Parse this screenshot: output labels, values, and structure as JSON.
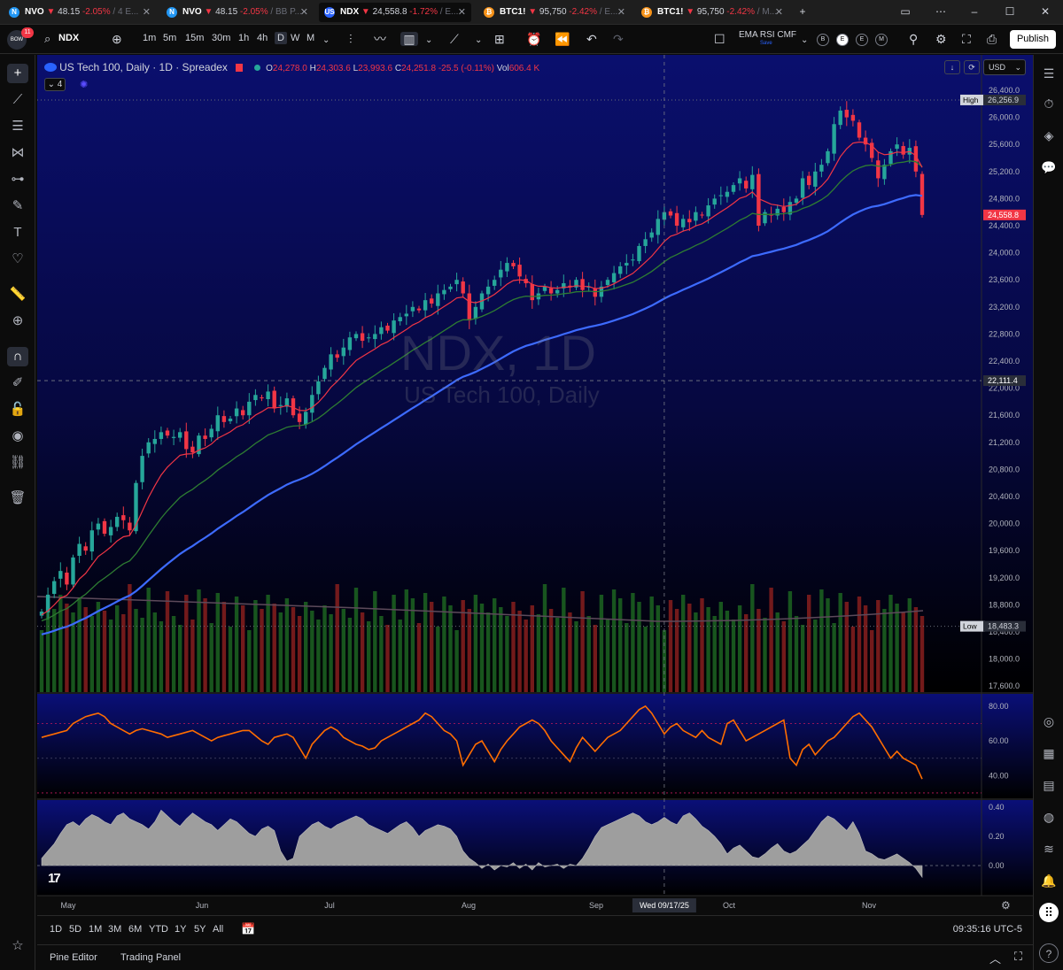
{
  "tabs": [
    {
      "symbol": "NVO",
      "arrow": "▼",
      "price": "48.15",
      "change": "-2.05%",
      "rest": "/ 4 E...",
      "icon": "N",
      "iconColor": "#2196f3"
    },
    {
      "symbol": "NVO",
      "arrow": "▼",
      "price": "48.15",
      "change": "-2.05%",
      "rest": "/ BB P...",
      "icon": "N",
      "iconColor": "#2196f3"
    },
    {
      "symbol": "NDX",
      "arrow": "▼",
      "price": "24,558.8",
      "change": "-1.72%",
      "rest": "/ E...",
      "icon": "US",
      "iconColor": "#2962ff"
    },
    {
      "symbol": "BTC1!",
      "arrow": "▼",
      "price": "95,750",
      "change": "-2.42%",
      "rest": "/ E...",
      "icon": "₿",
      "iconColor": "#f7931a"
    },
    {
      "symbol": "BTC1!",
      "arrow": "▼",
      "price": "95,750",
      "change": "-2.42%",
      "rest": "/ M...",
      "icon": "₿",
      "iconColor": "#f7931a"
    }
  ],
  "toolbar": {
    "symbol": "NDX",
    "intervals": [
      "1m",
      "5m",
      "15m",
      "30m",
      "1h",
      "4h",
      "D",
      "W",
      "M"
    ],
    "active_interval": "D",
    "indicators_label": "EMA RSI CMF",
    "indicators_sub": "Save",
    "session_buttons": [
      "B",
      "E",
      "E",
      "M"
    ],
    "publish": "Publish",
    "notif_count": "11"
  },
  "legend": {
    "title": "US Tech 100, Daily · 1D · Spreadex",
    "o_label": "O",
    "o": "24,278.0",
    "h_label": "H",
    "h": "24,303.6",
    "l_label": "L",
    "l": "23,993.6",
    "c_label": "C",
    "c": "24,251.8",
    "chg": "-25.5 (-0.11%)",
    "vol_label": "Vol",
    "vol": "606.4 K",
    "collapsed_count": "4"
  },
  "watermark": {
    "line1": "NDX, 1D",
    "line2": "US Tech 100, Daily"
  },
  "currency": "USD",
  "price_axis": {
    "ticks": [
      "26,400.0",
      "26,000.0",
      "25,600.0",
      "25,200.0",
      "24,800.0",
      "24,400.0",
      "24,000.0",
      "23,600.0",
      "23,200.0",
      "22,800.0",
      "22,400.0",
      "22,000.0",
      "21,600.0",
      "21,200.0",
      "20,800.0",
      "20,400.0",
      "20,000.0",
      "19,600.0",
      "19,200.0",
      "18,800.0",
      "18,400.0",
      "18,000.0",
      "17,600.0"
    ],
    "high_label": "High",
    "high": "26,256.9",
    "low_label": "Low",
    "low": "18,483.3",
    "last": "24,558.8",
    "crosshair": "22,111.4"
  },
  "rsi_axis": {
    "ticks": [
      "80.00",
      "60.00",
      "40.00"
    ]
  },
  "cmf_axis": {
    "ticks": [
      "0.40",
      "0.20",
      "0.00"
    ]
  },
  "time_axis": {
    "labels": [
      "May",
      "Jun",
      "Jul",
      "Aug",
      "Sep",
      "Oct",
      "Nov"
    ],
    "crosshair": "Wed 09/17/25"
  },
  "ranges": [
    "1D",
    "5D",
    "1M",
    "3M",
    "6M",
    "YTD",
    "1Y",
    "5Y",
    "All"
  ],
  "clock": "09:35:16 UTC-5",
  "footer": {
    "pine": "Pine Editor",
    "trading": "Trading Panel"
  },
  "colors": {
    "up": "#26a69a",
    "down": "#f23645",
    "ema_fast": "#f23645",
    "ema_mid": "#2e7d32",
    "ema_slow": "#3d6bff",
    "rsi": "#ff6d00",
    "cmf": "#9e9e9e"
  },
  "chart_data": {
    "type": "candlestick",
    "symbol": "NDX",
    "timeframe": "1D",
    "x_range": [
      "May",
      "Nov"
    ],
    "ylim": [
      17600,
      26400
    ],
    "high": 26256.9,
    "low": 18483.3,
    "last": 24558.8,
    "closes": [
      18700,
      18950,
      19150,
      19300,
      19100,
      19500,
      19700,
      19600,
      19900,
      20000,
      19850,
      19950,
      20100,
      20050,
      19900,
      20600,
      21000,
      21200,
      21250,
      21350,
      21300,
      21280,
      21350,
      21100,
      21050,
      21300,
      21250,
      21400,
      21600,
      21500,
      21550,
      21700,
      21600,
      21800,
      21900,
      21850,
      21950,
      21700,
      21750,
      21850,
      21600,
      21500,
      21650,
      21900,
      22100,
      22300,
      22500,
      22450,
      22600,
      22750,
      22800,
      22700,
      22750,
      22800,
      22900,
      22850,
      23000,
      23050,
      23100,
      23200,
      23150,
      23300,
      23250,
      23400,
      23450,
      23500,
      23600,
      23400,
      23000,
      23200,
      23400,
      23500,
      23600,
      23750,
      23850,
      23800,
      23650,
      23550,
      23300,
      23400,
      23500,
      23400,
      23450,
      23550,
      23500,
      23600,
      23450,
      23500,
      23350,
      23500,
      23600,
      23700,
      23800,
      23850,
      23900,
      24100,
      24200,
      24300,
      24500,
      24600,
      24550,
      24400,
      24500,
      24450,
      24600,
      24550,
      24700,
      24800,
      24850,
      24900,
      25000,
      25100,
      24950,
      25150,
      24400,
      24600,
      24550,
      24650,
      24600,
      24750,
      24800,
      25100,
      25000,
      25200,
      25300,
      25500,
      25900,
      26100,
      26000,
      25950,
      25700,
      25600,
      25400,
      25100,
      25300,
      25500,
      25600,
      25450,
      25550,
      25200,
      24558.8
    ],
    "ema_fast_span": 9,
    "ema_mid_span": 21,
    "ema_slow_span": 50,
    "rsi_values": [
      62,
      63,
      64,
      65,
      66,
      70,
      72,
      74,
      75,
      76,
      74,
      70,
      68,
      66,
      64,
      66,
      67,
      66,
      65,
      64,
      62,
      63,
      64,
      65,
      66,
      64,
      62,
      60,
      62,
      63,
      64,
      65,
      66,
      66,
      63,
      60,
      58,
      62,
      63,
      64,
      62,
      56,
      50,
      58,
      62,
      66,
      68,
      66,
      62,
      60,
      58,
      57,
      55,
      56,
      60,
      62,
      64,
      66,
      68,
      70,
      72,
      76,
      74,
      70,
      66,
      64,
      60,
      46,
      52,
      58,
      60,
      54,
      48,
      55,
      60,
      64,
      68,
      70,
      72,
      70,
      66,
      60,
      56,
      52,
      48,
      56,
      62,
      58,
      54,
      58,
      62,
      64,
      66,
      70,
      74,
      78,
      80,
      76,
      70,
      64,
      68,
      70,
      66,
      64,
      62,
      66,
      62,
      60,
      58,
      70,
      72,
      66,
      60,
      62,
      64,
      66,
      68,
      70,
      72,
      50,
      46,
      55,
      58,
      52,
      56,
      60,
      62,
      66,
      70,
      74,
      76,
      72,
      68,
      62,
      56,
      50,
      54,
      50,
      48,
      46,
      38
    ],
    "rsi_levels": {
      "upper": 70,
      "mid": 50,
      "lower": 30
    },
    "cmf_values": [
      0.05,
      0.1,
      0.15,
      0.22,
      0.28,
      0.3,
      0.27,
      0.32,
      0.35,
      0.33,
      0.3,
      0.28,
      0.34,
      0.36,
      0.32,
      0.3,
      0.28,
      0.25,
      0.3,
      0.38,
      0.34,
      0.3,
      0.27,
      0.32,
      0.36,
      0.33,
      0.3,
      0.28,
      0.24,
      0.28,
      0.32,
      0.3,
      0.26,
      0.22,
      0.2,
      0.25,
      0.27,
      0.24,
      0.1,
      0.03,
      0.05,
      0.2,
      0.24,
      0.28,
      0.3,
      0.27,
      0.25,
      0.28,
      0.3,
      0.32,
      0.34,
      0.32,
      0.28,
      0.26,
      0.24,
      0.22,
      0.25,
      0.28,
      0.3,
      0.26,
      0.2,
      0.24,
      0.26,
      0.28,
      0.27,
      0.25,
      0.2,
      0.1,
      0.05,
      0.02,
      -0.02,
      0.01,
      -0.03,
      0.0,
      -0.01,
      0.02,
      -0.02,
      0.01,
      -0.03,
      0.02,
      -0.01,
      0.0,
      0.01,
      -0.02,
      0.01,
      0.0,
      0.05,
      0.12,
      0.2,
      0.26,
      0.28,
      0.3,
      0.32,
      0.34,
      0.36,
      0.34,
      0.3,
      0.28,
      0.3,
      0.33,
      0.3,
      0.28,
      0.34,
      0.36,
      0.32,
      0.27,
      0.24,
      0.2,
      0.15,
      0.08,
      0.12,
      0.14,
      0.1,
      0.06,
      0.05,
      0.08,
      0.12,
      0.15,
      0.1,
      0.08,
      0.1,
      0.14,
      0.18,
      0.24,
      0.3,
      0.34,
      0.32,
      0.28,
      0.24,
      0.3,
      0.22,
      0.1,
      0.08,
      0.05,
      0.04,
      0.06,
      0.08,
      0.05,
      0.02,
      -0.02,
      -0.08
    ]
  }
}
